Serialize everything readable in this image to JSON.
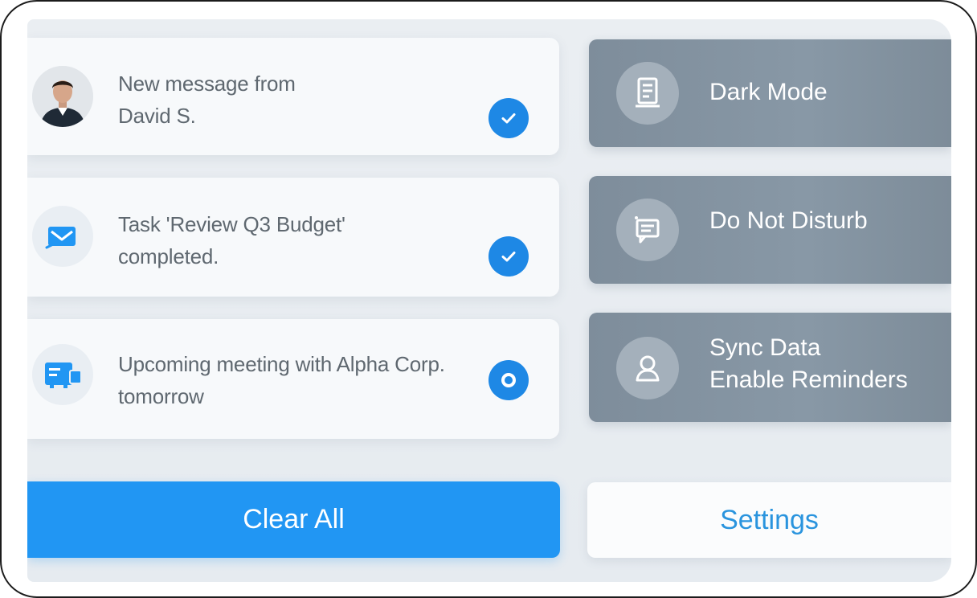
{
  "notifications": [
    {
      "text_line1": "New message from",
      "text_line2": "David S.",
      "icon": "user-avatar",
      "status": "checked"
    },
    {
      "text_line1": "Task 'Review Q3 Budget'",
      "text_line2": "completed.",
      "icon": "mail-check-icon",
      "status": "checked"
    },
    {
      "text_line1": "Upcoming meeting with Alpha Corp.",
      "text_line2": "tomorrow",
      "icon": "calendar-icon",
      "status": "radio"
    }
  ],
  "quick_settings": [
    {
      "label_line1": "Dark Mode",
      "label_line2": "",
      "icon": "document-icon"
    },
    {
      "label_line1": "Do Not Disturb",
      "label_line2": "",
      "icon": "message-box-icon"
    },
    {
      "label_line1": "Sync Data",
      "label_line2": "Enable Reminders",
      "icon": "user-icon"
    }
  ],
  "buttons": {
    "clear_all": "Clear All",
    "settings": "Settings"
  },
  "colors": {
    "accent": "#2196F3",
    "tile": "#8494A2",
    "card": "#F7F9FB",
    "background": "#E8EDF1"
  }
}
